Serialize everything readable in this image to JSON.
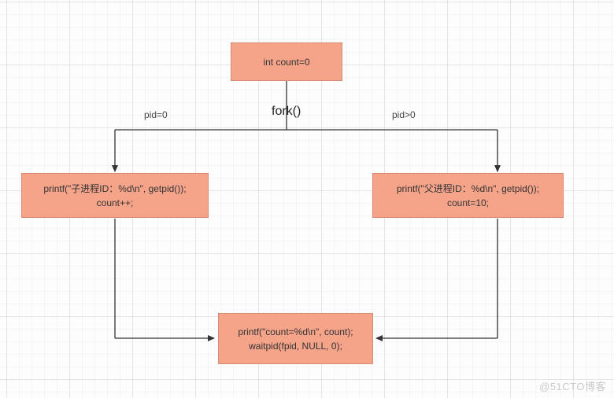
{
  "chart_data": {
    "type": "flowchart",
    "title": "",
    "nodes": [
      {
        "id": "init",
        "label_lines": [
          "int count=0"
        ]
      },
      {
        "id": "left",
        "label_lines": [
          "printf(\"子进程ID：%d\\n\", getpid());",
          "count++;"
        ]
      },
      {
        "id": "right",
        "label_lines": [
          "printf(\"父进程ID：%d\\n\", getpid());",
          "count=10;"
        ]
      },
      {
        "id": "bottom",
        "label_lines": [
          "printf(\"count=%d\\n\", count);",
          "waitpid(fpid, NULL, 0);"
        ]
      }
    ],
    "edges": [
      {
        "from": "init",
        "to": "left",
        "label": "pid=0"
      },
      {
        "from": "init",
        "to": "right",
        "label": "pid>0"
      },
      {
        "from": "left",
        "to": "bottom",
        "label": ""
      },
      {
        "from": "right",
        "to": "bottom",
        "label": ""
      }
    ],
    "branch_label": "fork()"
  },
  "labels": {
    "fork": "fork()",
    "pid_eq_0": "pid=0",
    "pid_gt_0": "pid>0"
  },
  "nodes": {
    "init_line1": "int count=0",
    "left_line1": "printf(\"子进程ID：%d\\n\", getpid());",
    "left_line2": "count++;",
    "right_line1": "printf(\"父进程ID：%d\\n\", getpid());",
    "right_line2": "count=10;",
    "bottom_line1": "printf(\"count=%d\\n\", count);",
    "bottom_line2": "waitpid(fpid, NULL, 0);"
  },
  "watermark": "@51CTO博客",
  "colors": {
    "node_fill": "#f5a48a",
    "node_border": "#d88b72",
    "line": "#333333"
  }
}
